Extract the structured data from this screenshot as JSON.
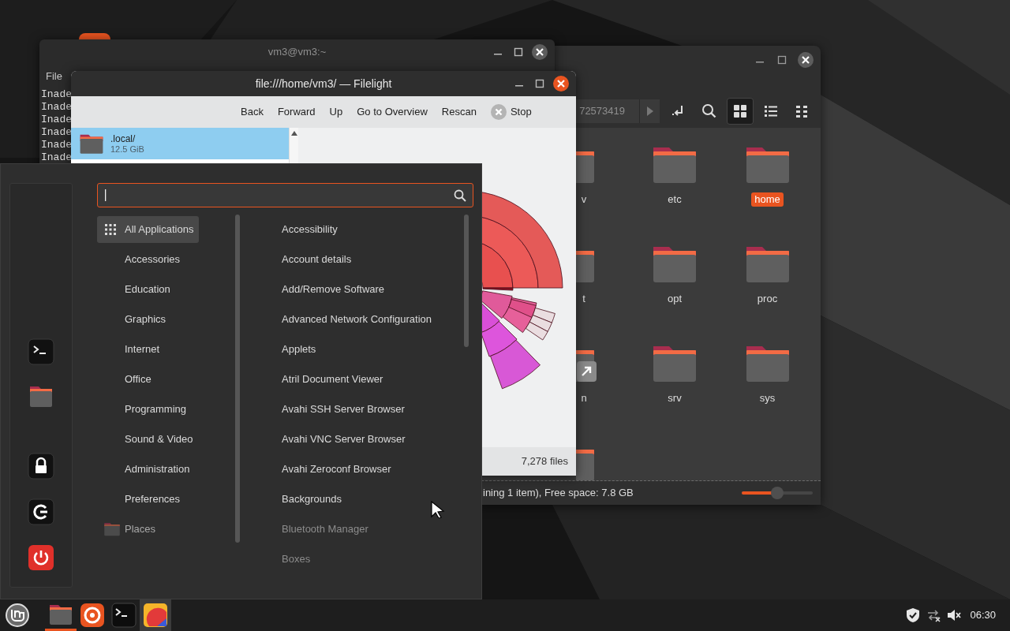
{
  "terminal": {
    "title": "vm3@vm3:~",
    "menu": [
      "File"
    ],
    "lines": [
      "Inade",
      "Inade",
      "Inade",
      "Inade",
      "Inade",
      "Inade"
    ]
  },
  "file_manager": {
    "path": "72573419",
    "views": [
      {
        "kind": "icons",
        "selected": true
      },
      {
        "kind": "list",
        "selected": false
      },
      {
        "kind": "compact",
        "selected": false
      }
    ],
    "folders": [
      {
        "label": "v",
        "kind": "folder",
        "selected": false
      },
      {
        "label": "etc",
        "kind": "folder",
        "selected": false
      },
      {
        "label": "home",
        "kind": "folder",
        "selected": true
      },
      {
        "label": "t",
        "kind": "folder",
        "selected": false
      },
      {
        "label": "opt",
        "kind": "folder",
        "selected": false
      },
      {
        "label": "proc",
        "kind": "folder",
        "selected": false
      },
      {
        "label": "n",
        "kind": "link",
        "selected": false
      },
      {
        "label": "srv",
        "kind": "folder",
        "selected": false
      },
      {
        "label": "sys",
        "kind": "folder",
        "selected": false
      },
      {
        "kind": "folder"
      }
    ],
    "status": "ining 1 item), Free space: 7.8 GB",
    "zoom": {
      "level": 0.5
    }
  },
  "filelight": {
    "title": "file:///home/vm3/ — Filelight",
    "toolbar": [
      {
        "label": "Back",
        "kind": "text"
      },
      {
        "label": "Forward",
        "kind": "text"
      },
      {
        "label": "Up",
        "kind": "text"
      },
      {
        "label": "Go to Overview",
        "kind": "text"
      },
      {
        "label": "Rescan",
        "kind": "text"
      },
      {
        "label": "Stop",
        "kind": "stop"
      }
    ],
    "items": [
      {
        "name": ".local/",
        "size": "12.5 GiB",
        "selected": true
      }
    ],
    "status": "7,278 files"
  },
  "menu": {
    "search": {
      "focused": true
    },
    "favorites": [
      {
        "kind": "terminal"
      },
      {
        "kind": "files"
      },
      {
        "kind": "lock"
      },
      {
        "kind": "logout"
      },
      {
        "kind": "power"
      }
    ],
    "categories": [
      {
        "label": "All Applications",
        "kind": "all",
        "selected": true
      },
      {
        "label": "Accessories",
        "kind": "plain",
        "selected": false
      },
      {
        "label": "Education",
        "kind": "plain",
        "selected": false
      },
      {
        "label": "Graphics",
        "kind": "plain",
        "selected": false
      },
      {
        "label": "Internet",
        "kind": "plain",
        "selected": false
      },
      {
        "label": "Office",
        "kind": "plain",
        "selected": false
      },
      {
        "label": "Programming",
        "kind": "plain",
        "selected": false
      },
      {
        "label": "Sound & Video",
        "kind": "plain",
        "selected": false
      },
      {
        "label": "Administration",
        "kind": "plain",
        "selected": false
      },
      {
        "label": "Preferences",
        "kind": "plain",
        "selected": false
      },
      {
        "label": "Places",
        "kind": "places",
        "selected": false
      }
    ],
    "apps": [
      {
        "label": "Accessibility",
        "faded": false
      },
      {
        "label": "Account details",
        "faded": false
      },
      {
        "label": "Add/Remove Software",
        "faded": false
      },
      {
        "label": "Advanced Network Configuration",
        "faded": false
      },
      {
        "label": "Applets",
        "faded": false
      },
      {
        "label": "Atril Document Viewer",
        "faded": false
      },
      {
        "label": "Avahi SSH Server Browser",
        "faded": false
      },
      {
        "label": "Avahi VNC Server Browser",
        "faded": false
      },
      {
        "label": "Avahi Zeroconf Browser",
        "faded": false
      },
      {
        "label": "Backgrounds",
        "faded": false
      },
      {
        "label": "Bluetooth Manager",
        "faded": true
      },
      {
        "label": "Boxes",
        "faded": true
      }
    ]
  },
  "taskbar": {
    "launchers": [
      {
        "kind": "files",
        "running": true,
        "selected": false
      },
      {
        "kind": "firefox",
        "running": false,
        "selected": false
      },
      {
        "kind": "terminal",
        "running": false,
        "selected": false
      },
      {
        "kind": "filelight",
        "running": false,
        "selected": true
      }
    ],
    "tray": [
      {
        "kind": "shield"
      },
      {
        "kind": "network"
      },
      {
        "kind": "muted"
      }
    ],
    "clock": "06:30"
  }
}
